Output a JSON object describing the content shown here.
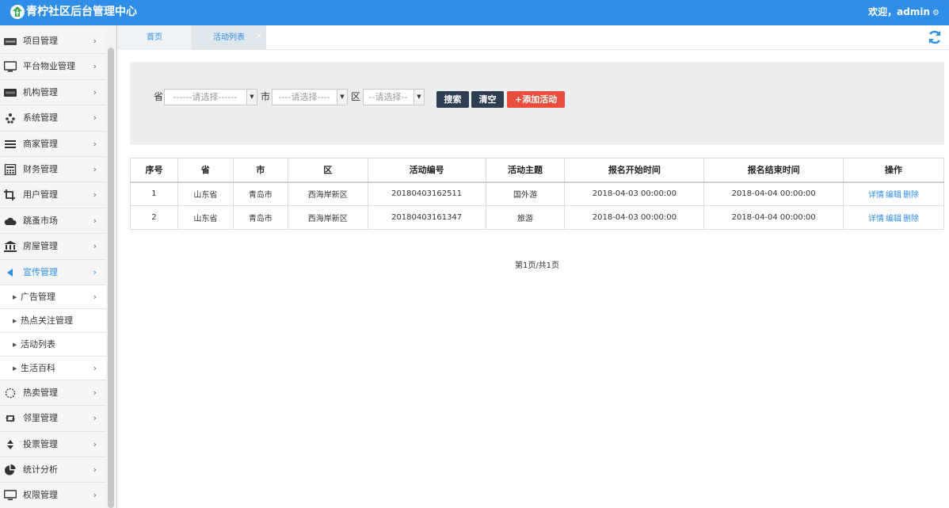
{
  "header": {
    "title": "青柠社区后台管理中心",
    "welcome": "欢迎，admin"
  },
  "sidebar": {
    "items": [
      {
        "label": "项目管理",
        "icon": "discover-card-icon"
      },
      {
        "label": "平台物业管理",
        "icon": "monitor-icon"
      },
      {
        "label": "机构管理",
        "icon": "stripe-card-icon"
      },
      {
        "label": "系统管理",
        "icon": "yelp-icon"
      },
      {
        "label": "商家管理",
        "icon": "bars-icon"
      },
      {
        "label": "财务管理",
        "icon": "calculator-icon"
      },
      {
        "label": "用户管理",
        "icon": "crop-icon"
      },
      {
        "label": "跳蚤市场",
        "icon": "cloud-icon"
      },
      {
        "label": "房屋管理",
        "icon": "bank-icon"
      },
      {
        "label": "宣传管理",
        "icon": "caret-left-icon"
      }
    ],
    "sub_items": [
      {
        "label": "广告管理"
      },
      {
        "label": "热点关注管理"
      },
      {
        "label": "活动列表"
      },
      {
        "label": "生活百科"
      }
    ],
    "items_after": [
      {
        "label": "热卖管理",
        "icon": "spinner-icon"
      },
      {
        "label": "邻里管理",
        "icon": "retweet-icon"
      },
      {
        "label": "投票管理",
        "icon": "sort-icon"
      },
      {
        "label": "统计分析",
        "icon": "pie-chart-icon"
      },
      {
        "label": "权限管理",
        "icon": "desktop-icon"
      }
    ]
  },
  "tabs": [
    {
      "label": "首页"
    },
    {
      "label": "活动列表"
    }
  ],
  "search": {
    "province_label": "省",
    "province_value": "------请选择------",
    "city_label": "市",
    "city_value": "----请选择----",
    "district_label": "区",
    "district_value": "--请选择--",
    "search_btn": "搜索",
    "clear_btn": "清空",
    "add_btn": "+添加活动"
  },
  "table": {
    "headers": [
      "序号",
      "省",
      "市",
      "区",
      "活动编号",
      "活动主题",
      "报名开始时间",
      "报名结束时间",
      "操作"
    ],
    "rows": [
      {
        "no": "1",
        "province": "山东省",
        "city": "青岛市",
        "district": "西海岸新区",
        "code": "20180403162511",
        "theme": "国外游",
        "start": "2018-04-03 00:00:00",
        "end": "2018-04-04 00:00:00"
      },
      {
        "no": "2",
        "province": "山东省",
        "city": "青岛市",
        "district": "西海岸新区",
        "code": "20180403161347",
        "theme": "旅游",
        "start": "2018-04-03 00:00:00",
        "end": "2018-04-04 00:00:00"
      }
    ],
    "actions": {
      "detail": "详情",
      "edit": "编辑",
      "delete": "删除"
    }
  },
  "pager": "第1页/共1页",
  "colors": {
    "header": "#2e8ee8",
    "dark_btn": "#2c3e50",
    "add_btn": "#e94e3c"
  }
}
